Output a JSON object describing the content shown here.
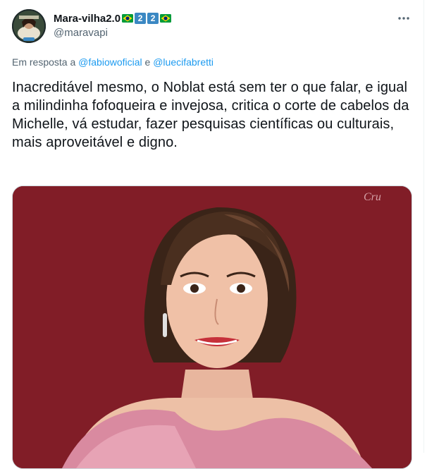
{
  "tweet": {
    "display_name": "Mara-vilha2.0",
    "badges": [
      "flag-brazil",
      "keycap-2",
      "keycap-2",
      "flag-brazil"
    ],
    "keycap_text": "2",
    "handle": "@maravapi",
    "reply_prefix": "Em resposta a",
    "reply_mentions": [
      "@fabiowoficial",
      "@luecifabretti"
    ],
    "reply_conjunction": "e",
    "text": "Inacreditável mesmo, o Noblat está sem ter o que falar, e igual a milindinha fofoqueira e invejosa, critica o corte de cabelos da Michelle, vá estudar, fazer pesquisas científicas ou culturais, mais aproveitável e digno.",
    "more_icon": "more-horizontal-icon",
    "media_signature": "Cru"
  },
  "colors": {
    "text_primary": "#0f1419",
    "text_secondary": "#536471",
    "link": "#1d9bf0",
    "media_background": "#7a1a22",
    "keycap": "#3b88c3"
  }
}
